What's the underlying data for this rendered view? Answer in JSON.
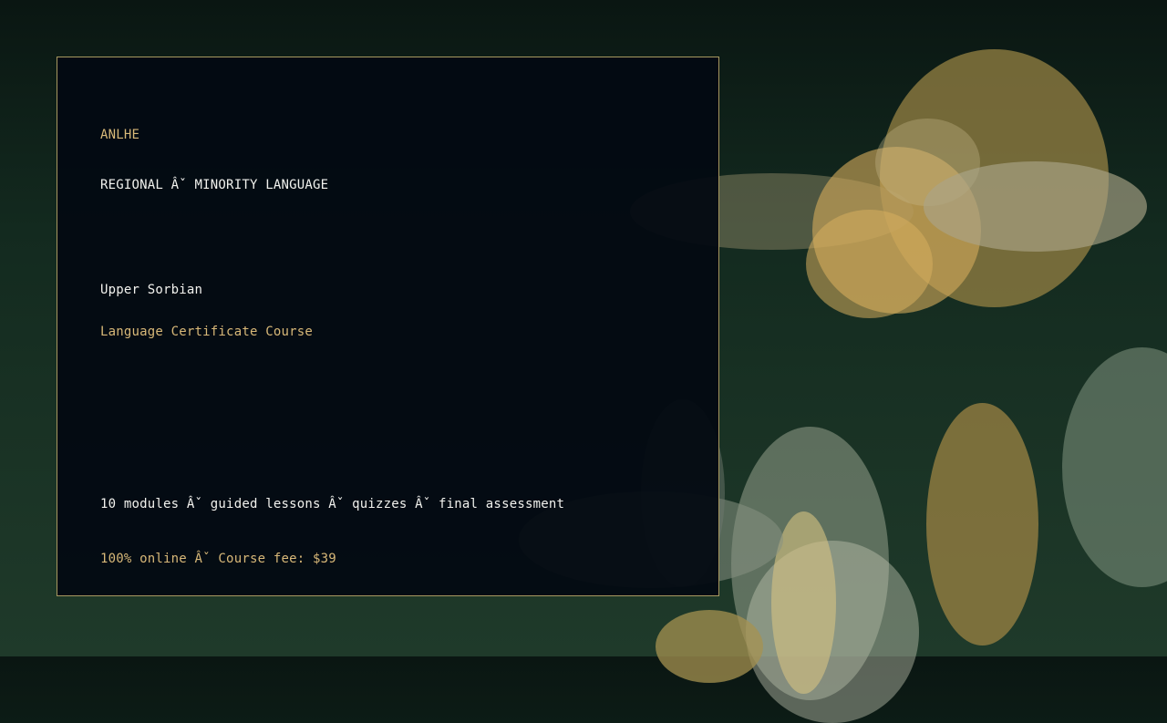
{
  "card": {
    "brand": "ANLHE",
    "category": "REGIONAL Âˇ MINORITY LANGUAGE",
    "language": "Upper Sorbian",
    "course_type": "Language Certificate Course",
    "features": "10 modules Âˇ guided lessons Âˇ quizzes Âˇ final assessment",
    "pricing": "100% online Âˇ Course fee: $39"
  },
  "colors": {
    "accent_gold": "#d8b878",
    "card_bg": "#030a12",
    "border": "#a89860",
    "text_light": "#f2f2ee"
  }
}
